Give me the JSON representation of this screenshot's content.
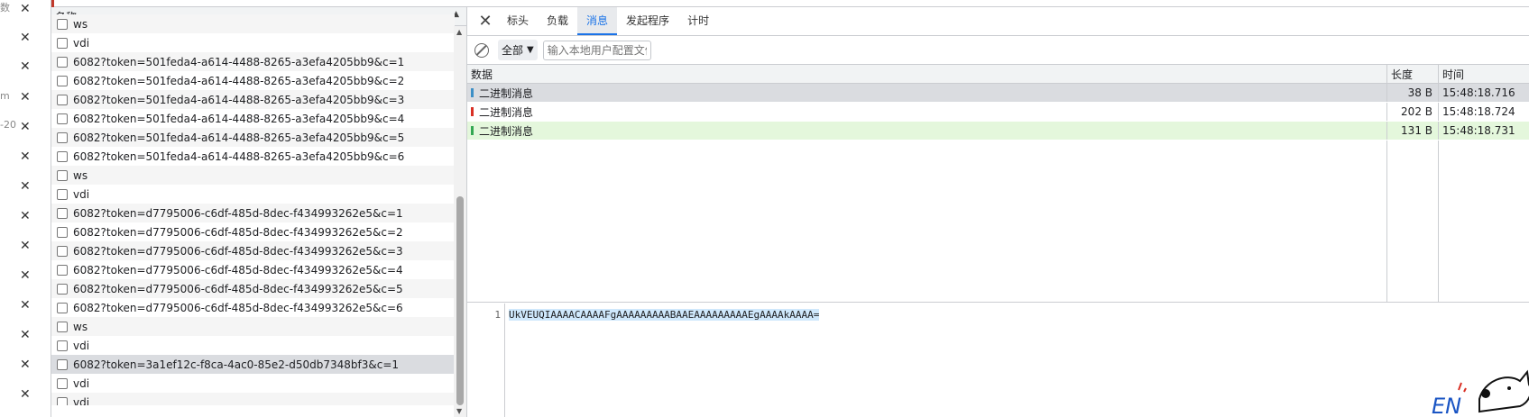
{
  "sidebar_fragments": [
    "数",
    "m",
    "-20"
  ],
  "request_list": {
    "header_label": "名称",
    "rows": [
      {
        "name": "ws"
      },
      {
        "name": "vdi"
      },
      {
        "name": "6082?token=501feda4-a614-4488-8265-a3efa4205bb9&c=1"
      },
      {
        "name": "6082?token=501feda4-a614-4488-8265-a3efa4205bb9&c=2"
      },
      {
        "name": "6082?token=501feda4-a614-4488-8265-a3efa4205bb9&c=3"
      },
      {
        "name": "6082?token=501feda4-a614-4488-8265-a3efa4205bb9&c=4"
      },
      {
        "name": "6082?token=501feda4-a614-4488-8265-a3efa4205bb9&c=5"
      },
      {
        "name": "6082?token=501feda4-a614-4488-8265-a3efa4205bb9&c=6"
      },
      {
        "name": "ws"
      },
      {
        "name": "vdi"
      },
      {
        "name": "6082?token=d7795006-c6df-485d-8dec-f434993262e5&c=1"
      },
      {
        "name": "6082?token=d7795006-c6df-485d-8dec-f434993262e5&c=2"
      },
      {
        "name": "6082?token=d7795006-c6df-485d-8dec-f434993262e5&c=3"
      },
      {
        "name": "6082?token=d7795006-c6df-485d-8dec-f434993262e5&c=4"
      },
      {
        "name": "6082?token=d7795006-c6df-485d-8dec-f434993262e5&c=5"
      },
      {
        "name": "6082?token=d7795006-c6df-485d-8dec-f434993262e5&c=6"
      },
      {
        "name": "ws"
      },
      {
        "name": "vdi"
      },
      {
        "name": "6082?token=3a1ef12c-f8ca-4ac0-85e2-d50db7348bf3&c=1",
        "selected": true
      },
      {
        "name": "vdi"
      },
      {
        "name": "vdi"
      }
    ]
  },
  "tabs": {
    "items": [
      {
        "label": "标头"
      },
      {
        "label": "负载"
      },
      {
        "label": "消息",
        "active": true
      },
      {
        "label": "发起程序"
      },
      {
        "label": "计时"
      }
    ]
  },
  "filter": {
    "select_label": "全部",
    "input_placeholder": "输入本地用户配置文件"
  },
  "messages": {
    "headers": {
      "data": "数据",
      "length": "长度",
      "time": "时间"
    },
    "rows": [
      {
        "data": "二进制消息",
        "length": "38 B",
        "time": "15:48:18.716",
        "direction": "send"
      },
      {
        "data": "二进制消息",
        "length": "202 B",
        "time": "15:48:18.724",
        "direction": "recv"
      },
      {
        "data": "二进制消息",
        "length": "131 B",
        "time": "15:48:18.731",
        "direction": "send"
      }
    ]
  },
  "preview": {
    "line_number": "1",
    "content": "UkVEUQIAAAACAAAAFgAAAAAAAAABAAEAAAAAAAAAEgAAAAkAAAA="
  },
  "colors": {
    "accent": "#1a73e8",
    "selected_row": "#dadce0",
    "green_row": "#e4f7dc"
  }
}
